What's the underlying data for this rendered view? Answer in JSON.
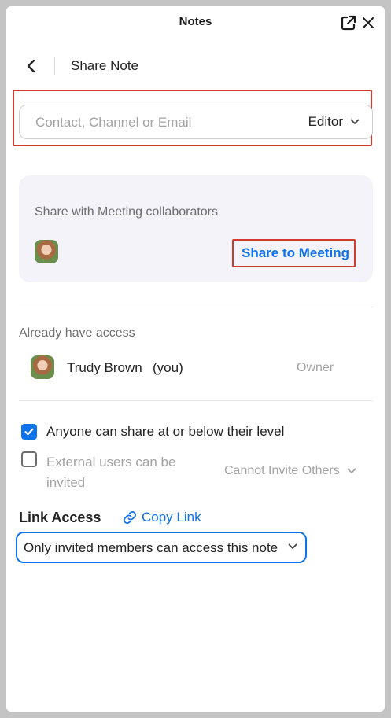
{
  "window": {
    "title": "Notes"
  },
  "header": {
    "title": "Share Note"
  },
  "invite": {
    "placeholder": "Contact, Channel or Email",
    "role": "Editor"
  },
  "collaborators": {
    "label": "Share with Meeting collaborators",
    "share_button": "Share to Meeting"
  },
  "access": {
    "label": "Already have access",
    "users": [
      {
        "name": "Trudy Brown",
        "suffix": "(you)",
        "role": "Owner"
      }
    ]
  },
  "options": [
    {
      "label": "Anyone can share at or below their level",
      "checked": true
    },
    {
      "label": "External users can be invited",
      "checked": false,
      "permission": "Cannot Invite Others"
    }
  ],
  "link_access": {
    "label": "Link Access",
    "copy_label": "Copy Link",
    "selected": "Only invited members can access this note"
  },
  "colors": {
    "accent": "#0e72ed",
    "highlight": "#d43a2c"
  }
}
